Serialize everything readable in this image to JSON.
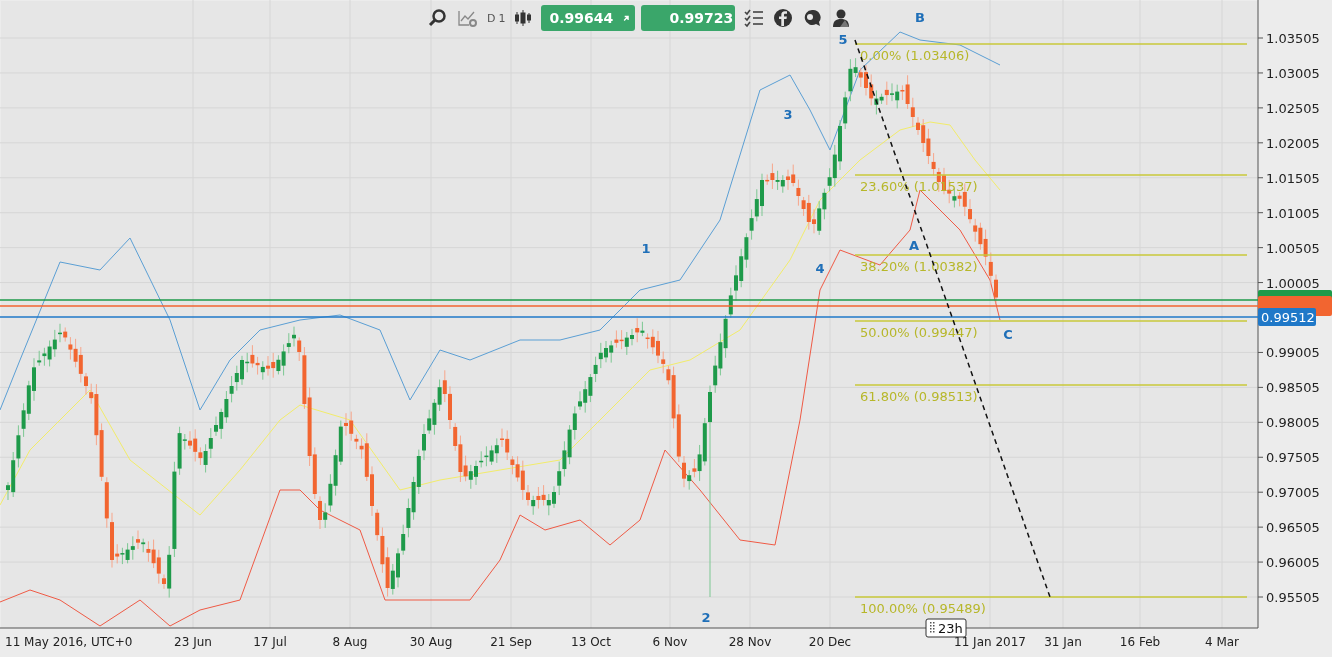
{
  "toolbar": {
    "timeframe_letter": "D",
    "timeframe_number": "1",
    "sell_price": "0.99644",
    "buy_price": "0.99723"
  },
  "price_axis": {
    "ticks": [
      "1.03505",
      "1.03005",
      "1.02505",
      "1.02005",
      "1.01505",
      "1.01005",
      "1.00505",
      "1.00005",
      "0.99005",
      "0.98505",
      "0.98005",
      "0.97505",
      "0.97005",
      "0.96505",
      "0.96005",
      "0.95505"
    ],
    "price_tags": [
      {
        "color": "#1e9a4a"
      },
      {
        "color": "#f26530"
      },
      {
        "color": "#1f78c8",
        "label": "0.99512"
      }
    ]
  },
  "time_axis": {
    "labels": [
      "11 May 2016, UTC+0",
      "23 Jun",
      "17 Jul",
      "8 Aug",
      "30 Aug",
      "21 Sep",
      "13 Oct",
      "6 Nov",
      "28 Nov",
      "20 Dec",
      "11 Jan 2017",
      "31 Jan",
      "16 Feb",
      "4 Mar"
    ],
    "cursor_label": "23h"
  },
  "fibonacci": [
    {
      "label": "0.00% (1.03406)"
    },
    {
      "label": "23.60% (1.01537)"
    },
    {
      "label": "38.20% (1.00382)"
    },
    {
      "label": "50.00% (0.99447)"
    },
    {
      "label": "61.80% (0.98513)"
    },
    {
      "label": "100.00% (0.95489)"
    }
  ],
  "wave_labels": [
    "5",
    "B",
    "3",
    "1",
    "4",
    "A",
    "2",
    "C"
  ]
}
